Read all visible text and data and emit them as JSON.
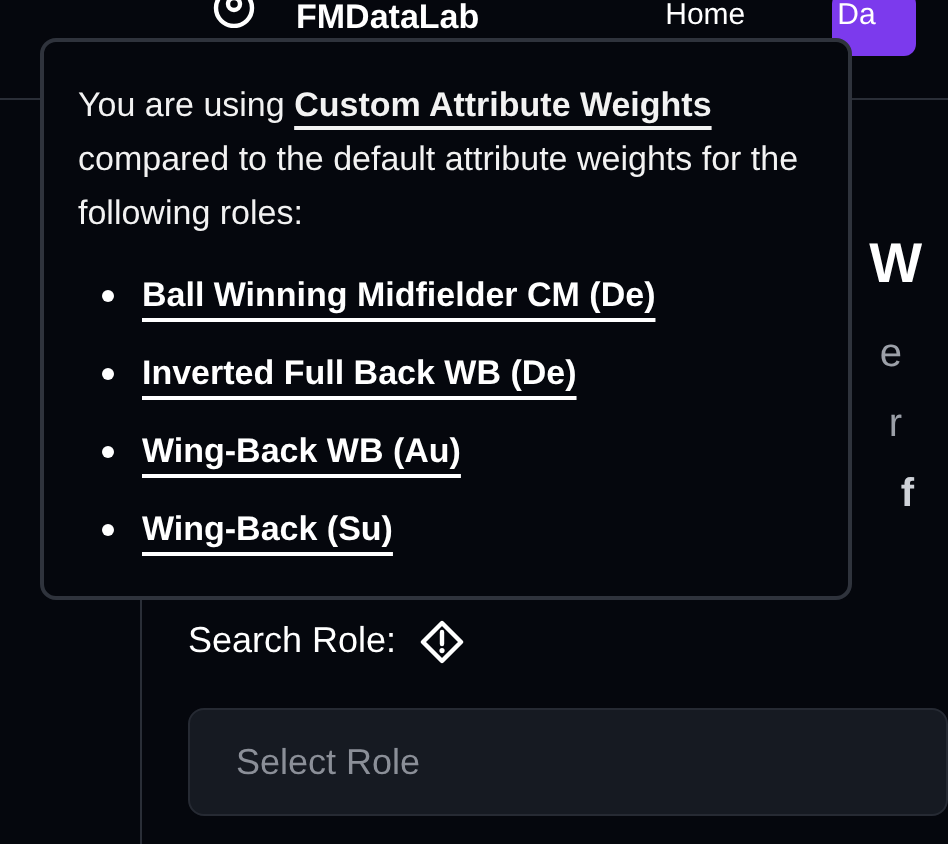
{
  "header": {
    "brand": "FMDataLab",
    "nav": [
      {
        "label": "Home",
        "selected": false
      },
      {
        "label": "Da",
        "selected": true
      }
    ]
  },
  "main": {
    "heading": "W",
    "lines": [
      "e",
      "r",
      "f"
    ],
    "search_label": "Search Role:",
    "select": {
      "placeholder": "Select Role"
    }
  },
  "tooltip": {
    "text": "You are using **Custom Attribute Weights** compared to the default attribute weights for the following roles:",
    "roles": [
      "Ball Winning Midfielder CM (De)",
      "Inverted Full Back WB (De)",
      "Wing-Back WB (Au)",
      "Wing-Back (Su)"
    ]
  }
}
